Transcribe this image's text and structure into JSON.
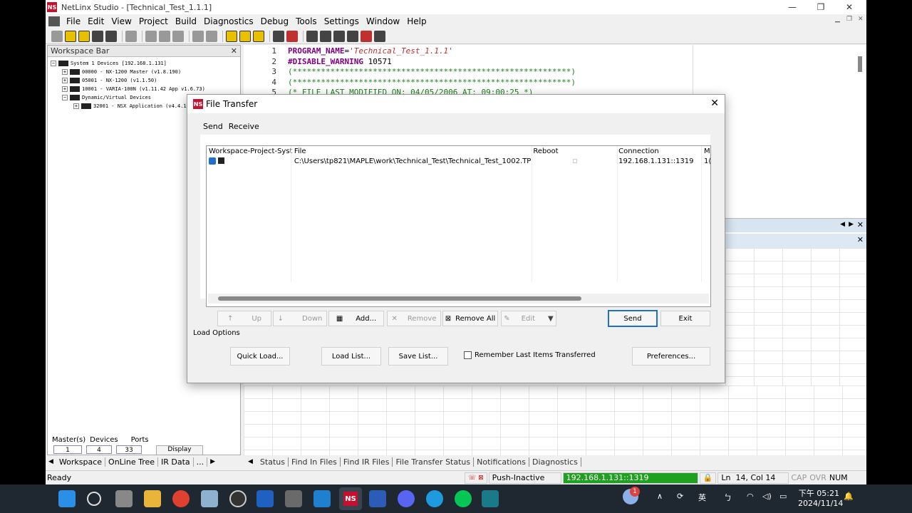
{
  "app": {
    "title": "NetLinx Studio - [Technical_Test_1.1.1]",
    "icon_text": "NS",
    "min": "—",
    "max": "❐",
    "close": "✕"
  },
  "menu": [
    "File",
    "Edit",
    "View",
    "Project",
    "Build",
    "Diagnostics",
    "Debug",
    "Tools",
    "Settings",
    "Window",
    "Help"
  ],
  "workspace": {
    "title": "Workspace Bar",
    "close": "✕",
    "tree": [
      {
        "pm": "−",
        "text": "System      1 Devices [192.168.1.131]",
        "indent": 0
      },
      {
        "pm": "+",
        "text": "00000 - NX-1200 Master (v1.8.190)",
        "indent": 1
      },
      {
        "pm": "+",
        "text": "05001 - NX-1200 (v1.1.50)",
        "indent": 1
      },
      {
        "pm": "+",
        "text": "10001 - VARIA-100N (v1.11.42 App v1.6.73)",
        "indent": 1
      },
      {
        "pm": "−",
        "text": "Dynamic/Virtual Devices",
        "indent": 1
      },
      {
        "pm": "+",
        "text": "32001 - NSX Application (v4.4.1",
        "indent": 2
      }
    ],
    "footer": {
      "labels": [
        "Master(s)",
        "Devices",
        "Ports"
      ],
      "values": [
        "1",
        "4",
        "33"
      ],
      "display_button": "Display"
    }
  },
  "editor": {
    "lines": [
      {
        "n": "1",
        "parts": [
          {
            "c": "kw",
            "t": "PROGRAM_NAME"
          },
          {
            "c": "",
            "t": "="
          },
          {
            "c": "str",
            "t": "'Technical_Test_1.1.1'"
          }
        ]
      },
      {
        "n": "2",
        "parts": [
          {
            "c": "kw",
            "t": "#DISABLE_WARNING"
          },
          {
            "c": "",
            "t": " 10571"
          }
        ]
      },
      {
        "n": "3",
        "parts": [
          {
            "c": "cmt",
            "t": "(***********************************************************)"
          }
        ]
      },
      {
        "n": "4",
        "parts": [
          {
            "c": "cmt",
            "t": "(***********************************************************)"
          }
        ]
      },
      {
        "n": "5",
        "parts": [
          {
            "c": "cmt",
            "t": "(*  FILE LAST MODIFIED ON: 04/05/2006  AT: 09:00:25        *)"
          }
        ]
      }
    ]
  },
  "bottom_tabs_left": [
    "Workspace",
    "OnLine Tree",
    "IR Data",
    "..."
  ],
  "bottom_tabs_right": [
    "Status",
    "Find In Files",
    "Find IR Files",
    "File Transfer Status",
    "Notifications",
    "Diagnostics"
  ],
  "statusbar": {
    "ready": "Ready",
    "push": "Push-Inactive",
    "connection": "192.168.1.131::1319",
    "ln_label": "Ln",
    "position": "14, Col 14",
    "cap": "CAP",
    "ovr": "OVR",
    "num": "NUM"
  },
  "dialog": {
    "title": "File Transfer",
    "close": "✕",
    "tabs": [
      "Send",
      "Receive"
    ],
    "columns": [
      "Workspace-Project-Syst...",
      "File",
      "Reboot",
      "Connection",
      "M"
    ],
    "rows": [
      {
        "file": "C:\\Users\\tp821\\MAPLE\\work\\Technical_Test\\Technical_Test_1002.TP5",
        "connection": "192.168.1.131::1319",
        "m": "1("
      }
    ],
    "buttons": {
      "up": "Up",
      "down": "Down",
      "add": "Add...",
      "remove": "Remove",
      "remove_all": "Remove All",
      "edit": "Edit",
      "send": "Send",
      "exit": "Exit",
      "quick_load": "Quick Load...",
      "load_list": "Load List...",
      "save_list": "Save List...",
      "preferences": "Preferences..."
    },
    "load_options": "Load Options",
    "remember": "Remember Last Items Transferred"
  },
  "taskbar": {
    "time": "下午 05:21",
    "date": "2024/11/14",
    "ime": "英",
    "badge": "1"
  }
}
